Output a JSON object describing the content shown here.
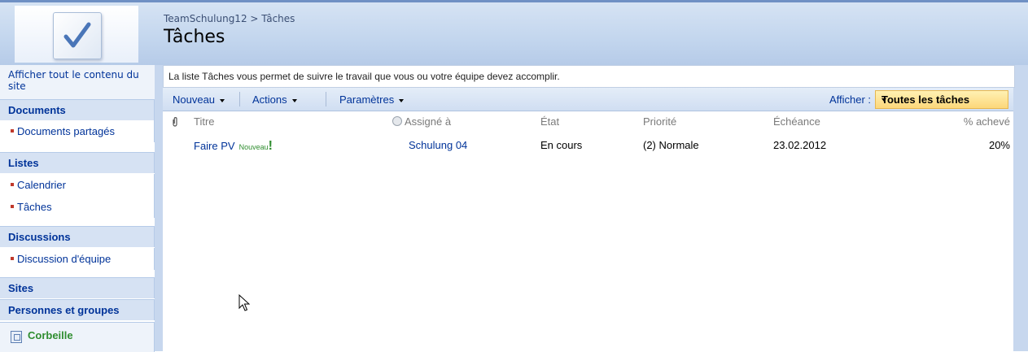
{
  "header": {
    "breadcrumb_site": "TeamSchulung12",
    "breadcrumb_sep": ">",
    "breadcrumb_current": "Tâches",
    "title": "Tâches",
    "logo_icon": "checklist-logo-icon"
  },
  "leftnav": {
    "view_all": "Afficher tout le contenu du site",
    "sections": [
      {
        "label": "Documents",
        "items": [
          "Documents partagés"
        ]
      },
      {
        "label": "Listes",
        "items": [
          "Calendrier",
          "Tâches"
        ]
      },
      {
        "label": "Discussions",
        "items": [
          "Discussion d'équipe"
        ]
      },
      {
        "label": "Sites",
        "items": []
      },
      {
        "label": "Personnes et groupes",
        "items": []
      }
    ],
    "recycle_bin": "Corbeille"
  },
  "main": {
    "description": "La liste Tâches vous permet de suivre le travail que vous ou votre équipe devez accomplir.",
    "toolbar": {
      "new": "Nouveau",
      "actions": "Actions",
      "settings": "Paramètres",
      "view_label": "Afficher :",
      "view_value": "Toutes les tâches"
    },
    "columns": [
      "Titre",
      "Assigné à",
      "État",
      "Priorité",
      "Échéance",
      "% achevé"
    ],
    "rows": [
      {
        "title": "Faire PV",
        "new_badge": "Nouveau",
        "new_mark": "!",
        "assigned_to": "Schulung 04",
        "status": "En cours",
        "priority": "(2) Normale",
        "due": "23.02.2012",
        "percent": "20%"
      }
    ]
  },
  "colors": {
    "link": "#003399",
    "nav_header_bg": "#d6e2f3",
    "recycle_green": "#2f8d2f",
    "view_select_bg": "#fcd77a"
  }
}
